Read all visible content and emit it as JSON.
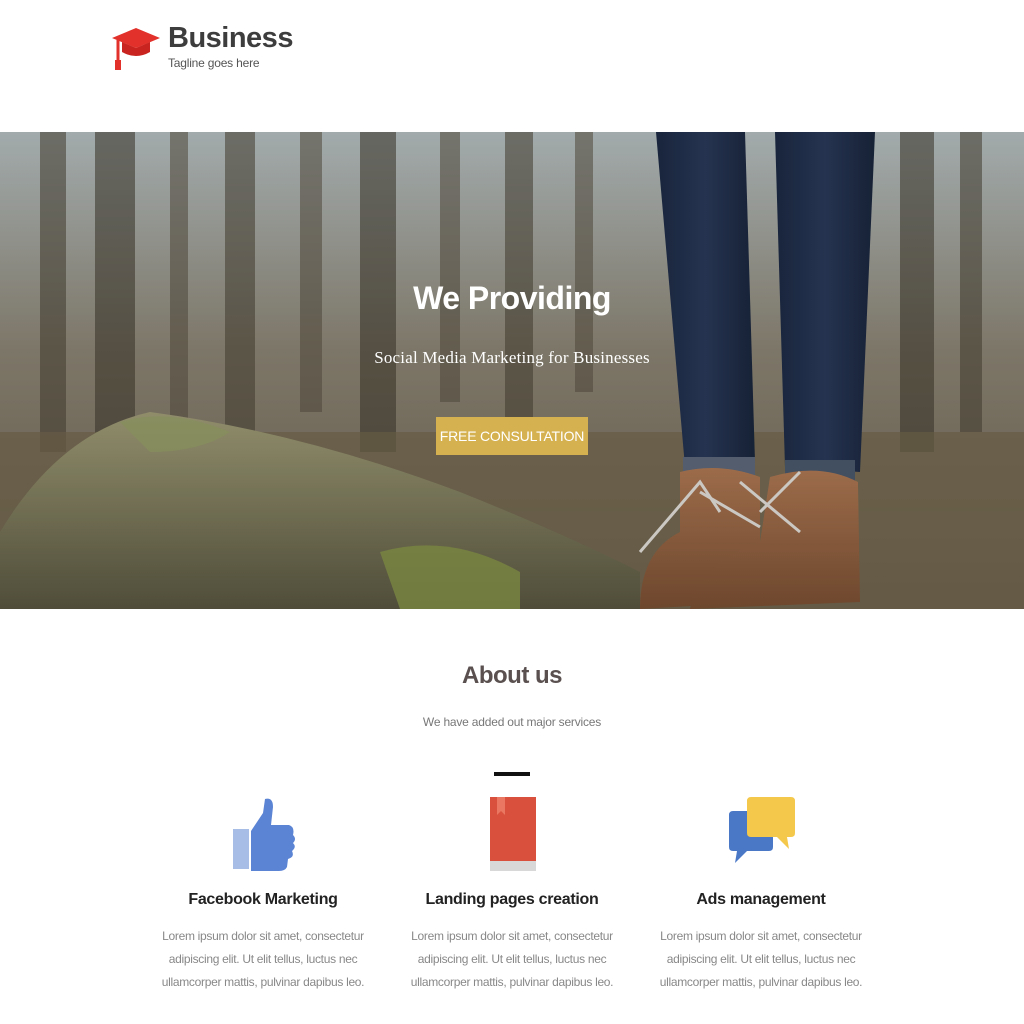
{
  "header": {
    "logo_title": "Business",
    "logo_tagline": "Tagline goes here",
    "logo_icon": "graduation-cap-icon",
    "brand_color": "#e2312a"
  },
  "hero": {
    "title": "We Providing",
    "subtitle": "Social Media Marketing for Businesses",
    "cta_label": "FREE CONSULTATION",
    "cta_color": "#d5b14f"
  },
  "about": {
    "title": "About us",
    "subtitle": "We have added out major services",
    "services": [
      {
        "icon": "thumbs-up-icon",
        "name": "Facebook Marketing",
        "description": "Lorem ipsum dolor sit amet, consectetur adipiscing elit. Ut elit tellus, luctus nec ullamcorper mattis, pulvinar dapibus leo."
      },
      {
        "icon": "book-icon",
        "name": "Landing pages creation",
        "description": "Lorem ipsum dolor sit amet, consectetur adipiscing elit. Ut elit tellus, luctus nec ullamcorper mattis, pulvinar dapibus leo."
      },
      {
        "icon": "chat-bubbles-icon",
        "name": "Ads management",
        "description": "Lorem ipsum dolor sit amet, consectetur adipiscing elit. Ut elit tellus, luctus nec ullamcorper mattis, pulvinar dapibus leo."
      }
    ]
  }
}
